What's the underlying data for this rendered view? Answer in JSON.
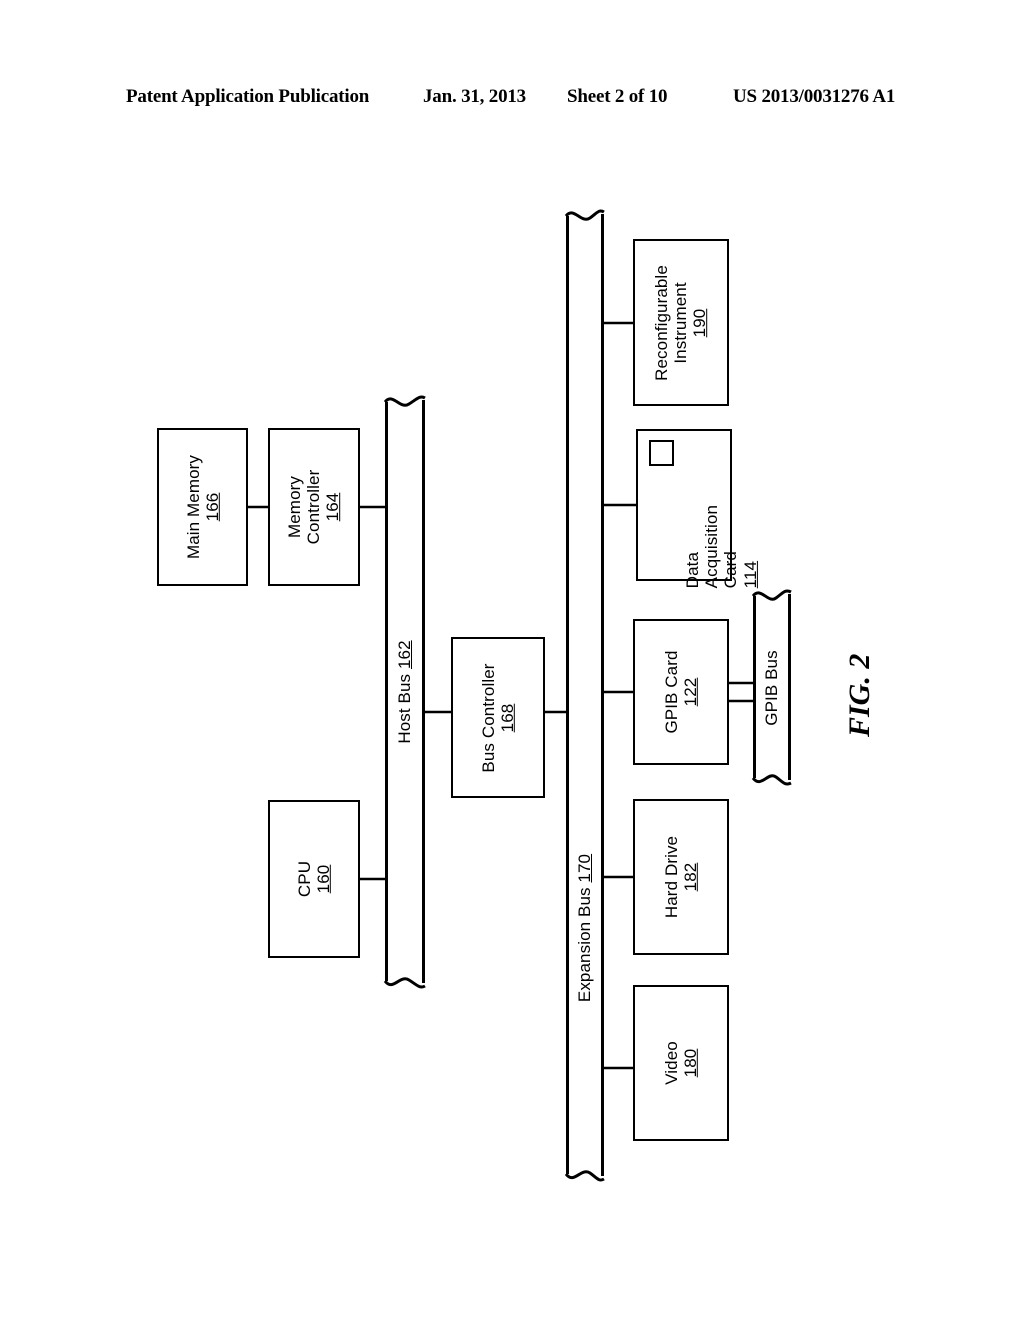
{
  "header": {
    "publication": "Patent Application Publication",
    "date": "Jan. 31, 2013",
    "sheet": "Sheet 2 of 10",
    "patent_number": "US 2013/0031276 A1"
  },
  "figure": {
    "caption": "FIG. 2",
    "nodes": [
      {
        "id": "main_memory",
        "name": "Main Memory",
        "ref": "166"
      },
      {
        "id": "memory_controller",
        "name": "Memory\nController",
        "ref": "164"
      },
      {
        "id": "cpu",
        "name": "CPU",
        "ref": "160"
      },
      {
        "id": "bus_controller",
        "name": "Bus Controller",
        "ref": "168"
      },
      {
        "id": "reconfigurable",
        "name": "Reconfigurable\nInstrument",
        "ref": "190"
      },
      {
        "id": "daq_card",
        "name": "Data\nAcquisition\nCard",
        "ref": "114"
      },
      {
        "id": "gpib_card",
        "name": "GPIB Card",
        "ref": "122"
      },
      {
        "id": "hard_drive",
        "name": "Hard Drive",
        "ref": "182"
      },
      {
        "id": "video",
        "name": "Video",
        "ref": "180"
      }
    ],
    "buses": [
      {
        "id": "host_bus",
        "name": "Host Bus",
        "ref": "162"
      },
      {
        "id": "expansion_bus",
        "name": "Expansion Bus",
        "ref": "170"
      },
      {
        "id": "gpib_bus",
        "name": "GPIB Bus",
        "ref": ""
      }
    ],
    "labels": {
      "main_memory_name": "Main Memory",
      "main_memory_ref": "166",
      "memory_controller_line1": "Memory",
      "memory_controller_line2": "Controller",
      "memory_controller_ref": "164",
      "cpu_name": "CPU",
      "cpu_ref": "160",
      "bus_controller_name": "Bus Controller",
      "bus_controller_ref": "168",
      "reconfigurable_line1": "Reconfigurable",
      "reconfigurable_line2": "Instrument",
      "reconfigurable_ref": "190",
      "daq_line1": "Data",
      "daq_line2": "Acquisition",
      "daq_line3": "Card",
      "daq_ref": "114",
      "gpib_card_name": "GPIB Card",
      "gpib_card_ref": "122",
      "hard_drive_name": "Hard Drive",
      "hard_drive_ref": "182",
      "video_name": "Video",
      "video_ref": "180",
      "host_bus_name": "Host Bus",
      "host_bus_ref": "162",
      "expansion_bus_name": "Expansion Bus",
      "expansion_bus_ref": "170",
      "gpib_bus_name": "GPIB Bus"
    },
    "colors": {
      "ink": "#000000",
      "paper": "#ffffff"
    }
  }
}
